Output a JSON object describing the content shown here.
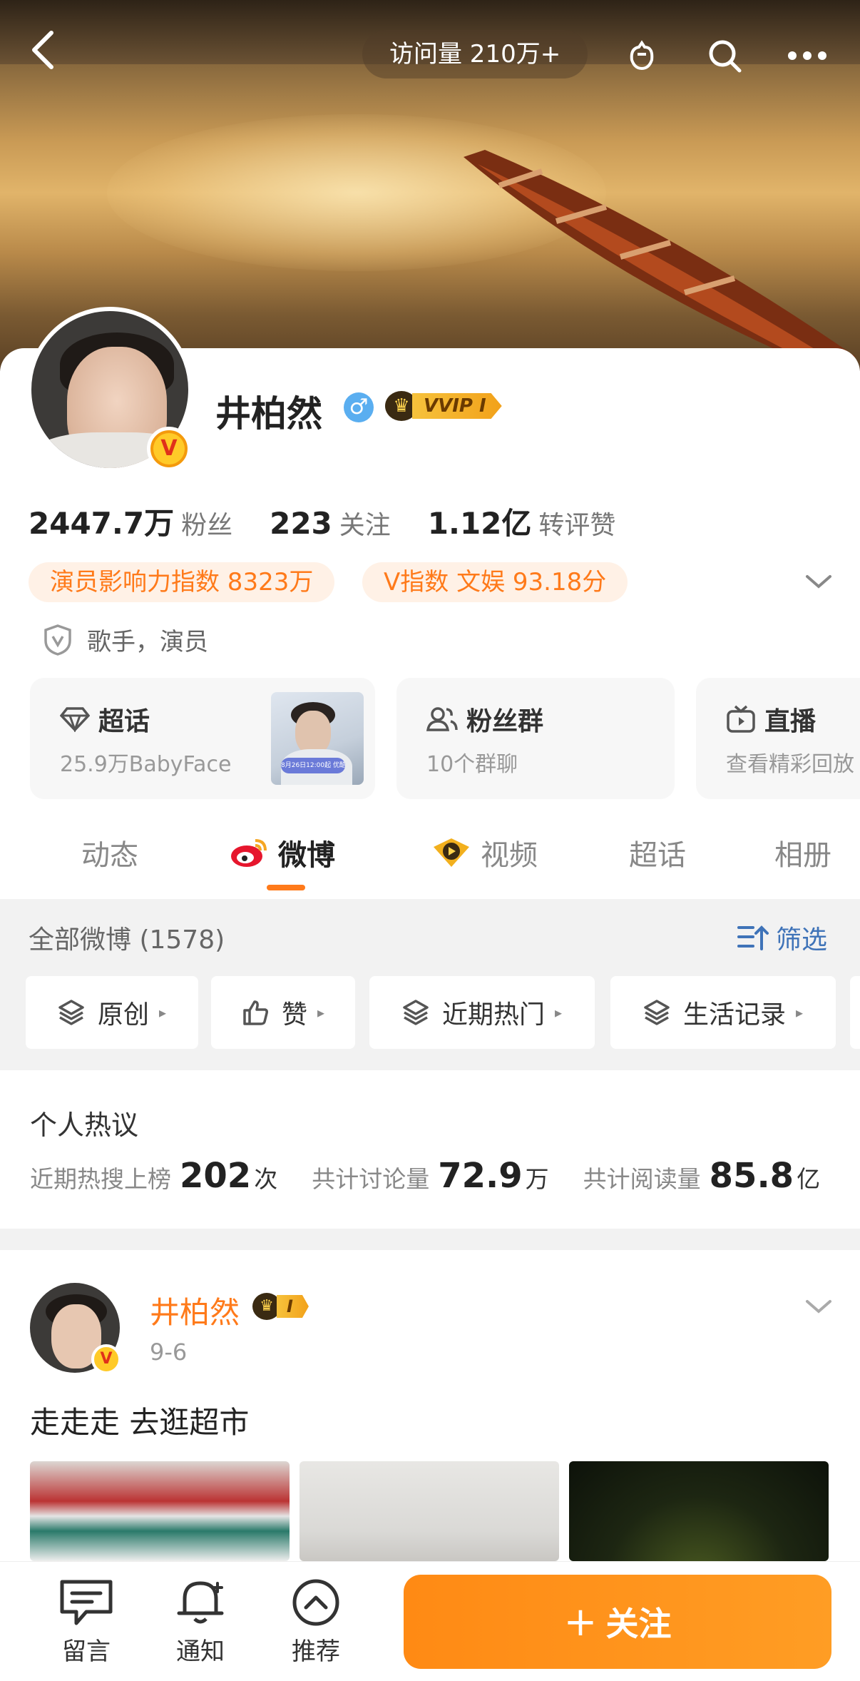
{
  "header": {
    "visits": "访问量 210万+",
    "icons": [
      "back-arrow-icon",
      "moment-hand-icon",
      "search-icon",
      "more-icon"
    ]
  },
  "profile": {
    "name": "井柏然",
    "gender_symbol": "♂",
    "vip_label": "VVIP I",
    "avatar_badge": "V",
    "stats": [
      {
        "value": "2447.7万",
        "label": "粉丝"
      },
      {
        "value": "223",
        "label": "关注"
      },
      {
        "value": "1.12亿",
        "label": "转评赞"
      }
    ],
    "pills": [
      "演员影响力指数 8323万",
      "V指数 文娱 93.18分"
    ],
    "verification": "歌手，演员"
  },
  "tiles": [
    {
      "title": "超话",
      "sub": "25.9万BabyFace",
      "icon": "diamond-icon",
      "thumb_text": "8月26日12:00起 优酷全网独播"
    },
    {
      "title": "粉丝群",
      "sub": "10个群聊",
      "icon": "group-icon"
    },
    {
      "title": "直播",
      "sub": "查看精彩回放",
      "icon": "tv-icon"
    }
  ],
  "tabs": [
    {
      "label": "动态",
      "active": false
    },
    {
      "label": "微博",
      "active": true
    },
    {
      "label": "视频",
      "active": false
    },
    {
      "label": "超话",
      "active": false
    },
    {
      "label": "相册",
      "active": false
    }
  ],
  "weibo_section": {
    "all_count": "全部微博 (1578)",
    "filter_label": "筛选",
    "chips": [
      {
        "label": "原创",
        "icon": "layers-icon"
      },
      {
        "label": "赞",
        "icon": "thumbs-up-icon"
      },
      {
        "label": "近期热门",
        "icon": "layers-icon"
      },
      {
        "label": "生活记录",
        "icon": "layers-icon"
      }
    ]
  },
  "hot_discussion": {
    "title": "个人热议",
    "items": [
      {
        "label": "近期热搜上榜",
        "value": "202",
        "unit": "次"
      },
      {
        "label": "共计讨论量",
        "value": "72.9",
        "unit": "万"
      },
      {
        "label": "共计阅读量",
        "value": "85.8",
        "unit": "亿"
      }
    ]
  },
  "post": {
    "author": "井柏然",
    "vip_label": "I",
    "date": "9-6",
    "text": "走走走 去逛超市",
    "badge": "V"
  },
  "bottom_bar": {
    "items": [
      {
        "label": "留言",
        "icon": "comment-icon"
      },
      {
        "label": "通知",
        "icon": "bell-icon"
      },
      {
        "label": "推荐",
        "icon": "chevron-up-circle-icon"
      }
    ],
    "follow_label": "关注",
    "follow_plus": "+"
  },
  "colors": {
    "accent": "#ff7a1a",
    "link": "#3f73b8",
    "follow_button": "#ff8a14"
  }
}
